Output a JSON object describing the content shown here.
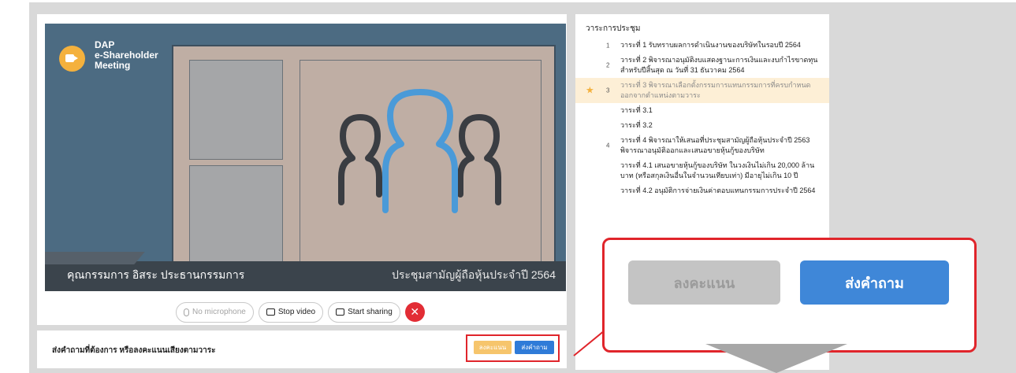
{
  "logo": {
    "text": "DAP\ne-Shareholder\nMeeting"
  },
  "video": {
    "speaker_caption": "คุณกรรมการ อิสระ ประธานกรรมการ",
    "meeting_caption": "ประชุมสามัญผู้ถือหุ้นประจำปี 2564"
  },
  "controls": {
    "mic_label": "No microphone",
    "video_label": "Stop video",
    "share_label": "Start sharing",
    "end_label": "✕"
  },
  "bottom": {
    "prompt": "ส่งคำถามที่ต้องการ หรือลงคะแนนเสียงตามวาระ",
    "vote_label": "ลงคะแนน",
    "ask_label": "ส่งคำถาม"
  },
  "agenda": {
    "title": "วาระการประชุม",
    "items": [
      {
        "num": "1",
        "text": "วาระที่ 1 รับทราบผลการดำเนินงานของบริษัทในรอบปี 2564"
      },
      {
        "num": "2",
        "text": "วาระที่ 2 พิจารณาอนุมัติงบแสดงฐานะการเงินและงบกำไรขาดทุนสำหรับปีสิ้นสุด ณ วันที่ 31 ธันวาคม 2564"
      },
      {
        "num": "3",
        "text": "วาระที่ 3 พิจารณาเลือกตั้งกรรมการแทนกรรมการที่ครบกำหนดออกจากตำแหน่งตามวาระ",
        "active": true
      },
      {
        "num": "",
        "text": "วาระที่ 3.1"
      },
      {
        "num": "",
        "text": "วาระที่ 3.2"
      },
      {
        "num": "4",
        "text": "วาระที่ 4 พิจารณาให้เสนอที่ประชุมสามัญผู้ถือหุ้นประจำปี 2563 พิจารณาอนุมัติออกและเสนอขายหุ้นกู้ของบริษัท"
      },
      {
        "num": "",
        "text": "วาระที่ 4.1 เสนอขายหุ้นกู้ของบริษัท ในวงเงินไม่เกิน 20,000 ล้านบาท (หรือสกุลเงินอื่นในจำนวนเทียบเท่า) มีอายุไม่เกิน 10 ปี"
      },
      {
        "num": "",
        "text": "วาระที่ 4.2 อนุมัติการจ่ายเงินค่าตอบแทนกรรมการประจำปี 2564"
      }
    ]
  },
  "callout": {
    "vote_label": "ลงคะแนน",
    "ask_label": "ส่งคำถาม"
  },
  "colors": {
    "accent_blue": "#3f87d8",
    "vote_orange": "#f6c56c",
    "highlight_red": "#e0252b",
    "active_row": "#fdefd6"
  },
  "icons": [
    "video-camera-icon",
    "microphone-off-icon",
    "video-icon",
    "share-screen-icon",
    "close-icon",
    "star-icon",
    "arrow-down-icon",
    "people-icon"
  ]
}
